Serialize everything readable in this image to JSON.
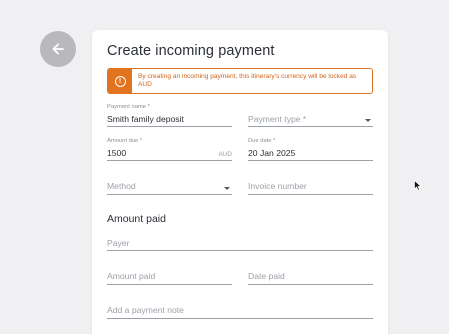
{
  "back_button": {
    "icon": "arrow-left-icon"
  },
  "form": {
    "title": "Create incoming payment",
    "alert": {
      "icon": "info-icon",
      "text_line1": "By creating an incoming payment, this itinerary's currency will be locked as",
      "text_line2": "AUD"
    },
    "payment_name": {
      "label": "Payment name *",
      "value": "Smith family deposit"
    },
    "payment_type": {
      "placeholder": "Payment type *"
    },
    "amount_due": {
      "label": "Amount due *",
      "value": "1500",
      "suffix": "AUD"
    },
    "due_date": {
      "label": "Due date *",
      "value": "20 Jan 2025"
    },
    "method": {
      "placeholder": "Method"
    },
    "invoice_number": {
      "placeholder": "Invoice number"
    },
    "amount_paid_section": "Amount paid",
    "payer": {
      "placeholder": "Payer"
    },
    "amount_paid": {
      "placeholder": "Amount paid"
    },
    "date_paid": {
      "placeholder": "Date paid"
    },
    "payment_note": {
      "placeholder": "Add a payment note"
    }
  },
  "colors": {
    "accent": "#e2741f",
    "background": "#f0f0f2",
    "card": "#ffffff",
    "back_button": "#b9b9bd"
  }
}
